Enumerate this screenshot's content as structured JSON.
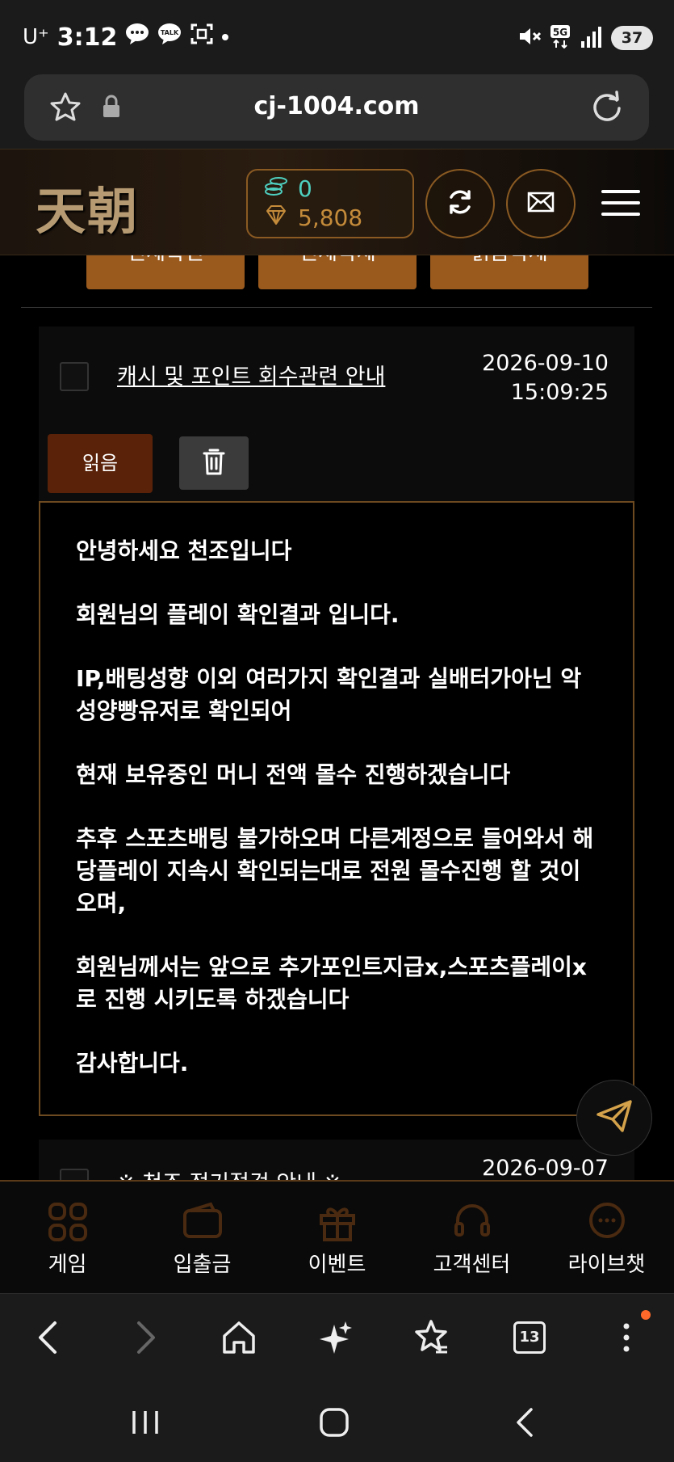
{
  "status_bar": {
    "carrier": "U⁺",
    "time": "3:12",
    "battery": "37"
  },
  "browser": {
    "url": "cj-1004.com",
    "tab_count": "13"
  },
  "header": {
    "logo": "天朝",
    "cash": "0",
    "points": "5,808"
  },
  "actions": {
    "select_all": "전체확인",
    "delete_all": "전체삭제",
    "read_delete": "읽음삭제"
  },
  "message": {
    "title": "캐시 및 포인트 회수관련 안내",
    "date": "2026-09-10",
    "time": "15:09:25",
    "read_label": "읽음",
    "paragraphs": [
      "안녕하세요 천조입니다",
      "회원님의 플레이 확인결과 입니다.",
      "IP,배팅성향 이외 여러가지 확인결과 실배터가아닌 악성양빵유저로 확인되어",
      "현재 보유중인 머니 전액 몰수 진행하겠습니다",
      "추후 스포츠배팅 불가하오며 다른계정으로 들어와서 해당플레이 지속시 확인되는대로 전원 몰수진행 할 것이오며,",
      "회원님께서는 앞으로 추가포인트지급x,스포츠플레이x 로 진행 시키도록 하겠습니다",
      "감사합니다."
    ]
  },
  "next_message": {
    "title": "※ 천조 정기점검 안내 ※",
    "date": "2026-09-07"
  },
  "bottom_nav": {
    "items": [
      {
        "label": "게임",
        "icon": "grid-icon"
      },
      {
        "label": "입출금",
        "icon": "wallet-icon"
      },
      {
        "label": "이벤트",
        "icon": "gift-icon"
      },
      {
        "label": "고객센터",
        "icon": "headset-icon"
      },
      {
        "label": "라이브챗",
        "icon": "chat-icon"
      }
    ]
  },
  "colors": {
    "accent": "#9a5a1e",
    "read_button": "#5a2208",
    "border": "#6e4a20",
    "cash": "#4ecfbf",
    "points": "#c48b3a"
  }
}
